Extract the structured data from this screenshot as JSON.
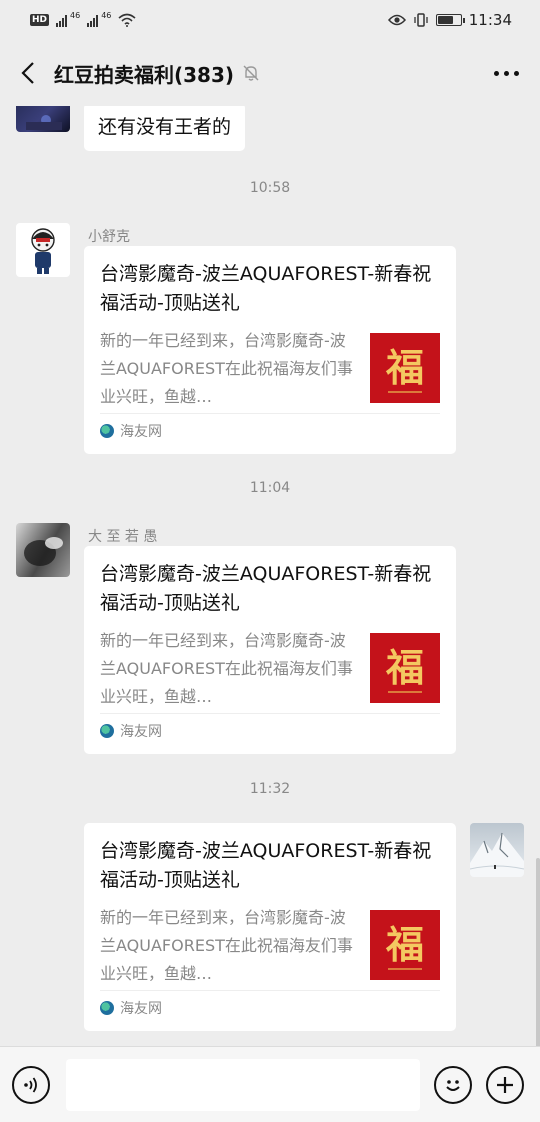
{
  "status_bar": {
    "hd": "HD",
    "sim1": "46",
    "sim2": "46",
    "time": "11:34"
  },
  "nav": {
    "title": "红豆拍卖福利(383)"
  },
  "messages": {
    "m0_text": "还有没有王者的",
    "ts1": "10:58",
    "m1_sender": "小舒克",
    "ts2": "11:04",
    "m2_sender": "大 至 若 愚",
    "ts3": "11:32"
  },
  "cards": [
    {
      "title": "台湾影魔奇-波兰AQUAFOREST-新春祝福活动-顶贴送礼",
      "desc": "新的一年已经到来，台湾影魔奇-波兰AQUAFOREST在此祝福海友们事业兴旺，鱼越…",
      "thumb_text": "福",
      "source": "海友网"
    },
    {
      "title": "台湾影魔奇-波兰AQUAFOREST-新春祝福活动-顶贴送礼",
      "desc": "新的一年已经到来，台湾影魔奇-波兰AQUAFOREST在此祝福海友们事业兴旺，鱼越…",
      "thumb_text": "福",
      "source": "海友网"
    },
    {
      "title": "台湾影魔奇-波兰AQUAFOREST-新春祝福活动-顶贴送礼",
      "desc": "新的一年已经到来，台湾影魔奇-波兰AQUAFOREST在此祝福海友们事业兴旺，鱼越…",
      "thumb_text": "福",
      "source": "海友网"
    }
  ],
  "icons": {
    "back": "chevron-left-icon",
    "mute": "bell-off-icon",
    "more": "more-icon",
    "voice": "voice-icon",
    "emoji": "emoji-icon",
    "plus": "plus-icon"
  },
  "colors": {
    "background": "#ededed",
    "bubble": "#ffffff",
    "thumb_red": "#c4121a",
    "thumb_gold": "#f4c861"
  },
  "status_bar_battery_level": 0.72
}
